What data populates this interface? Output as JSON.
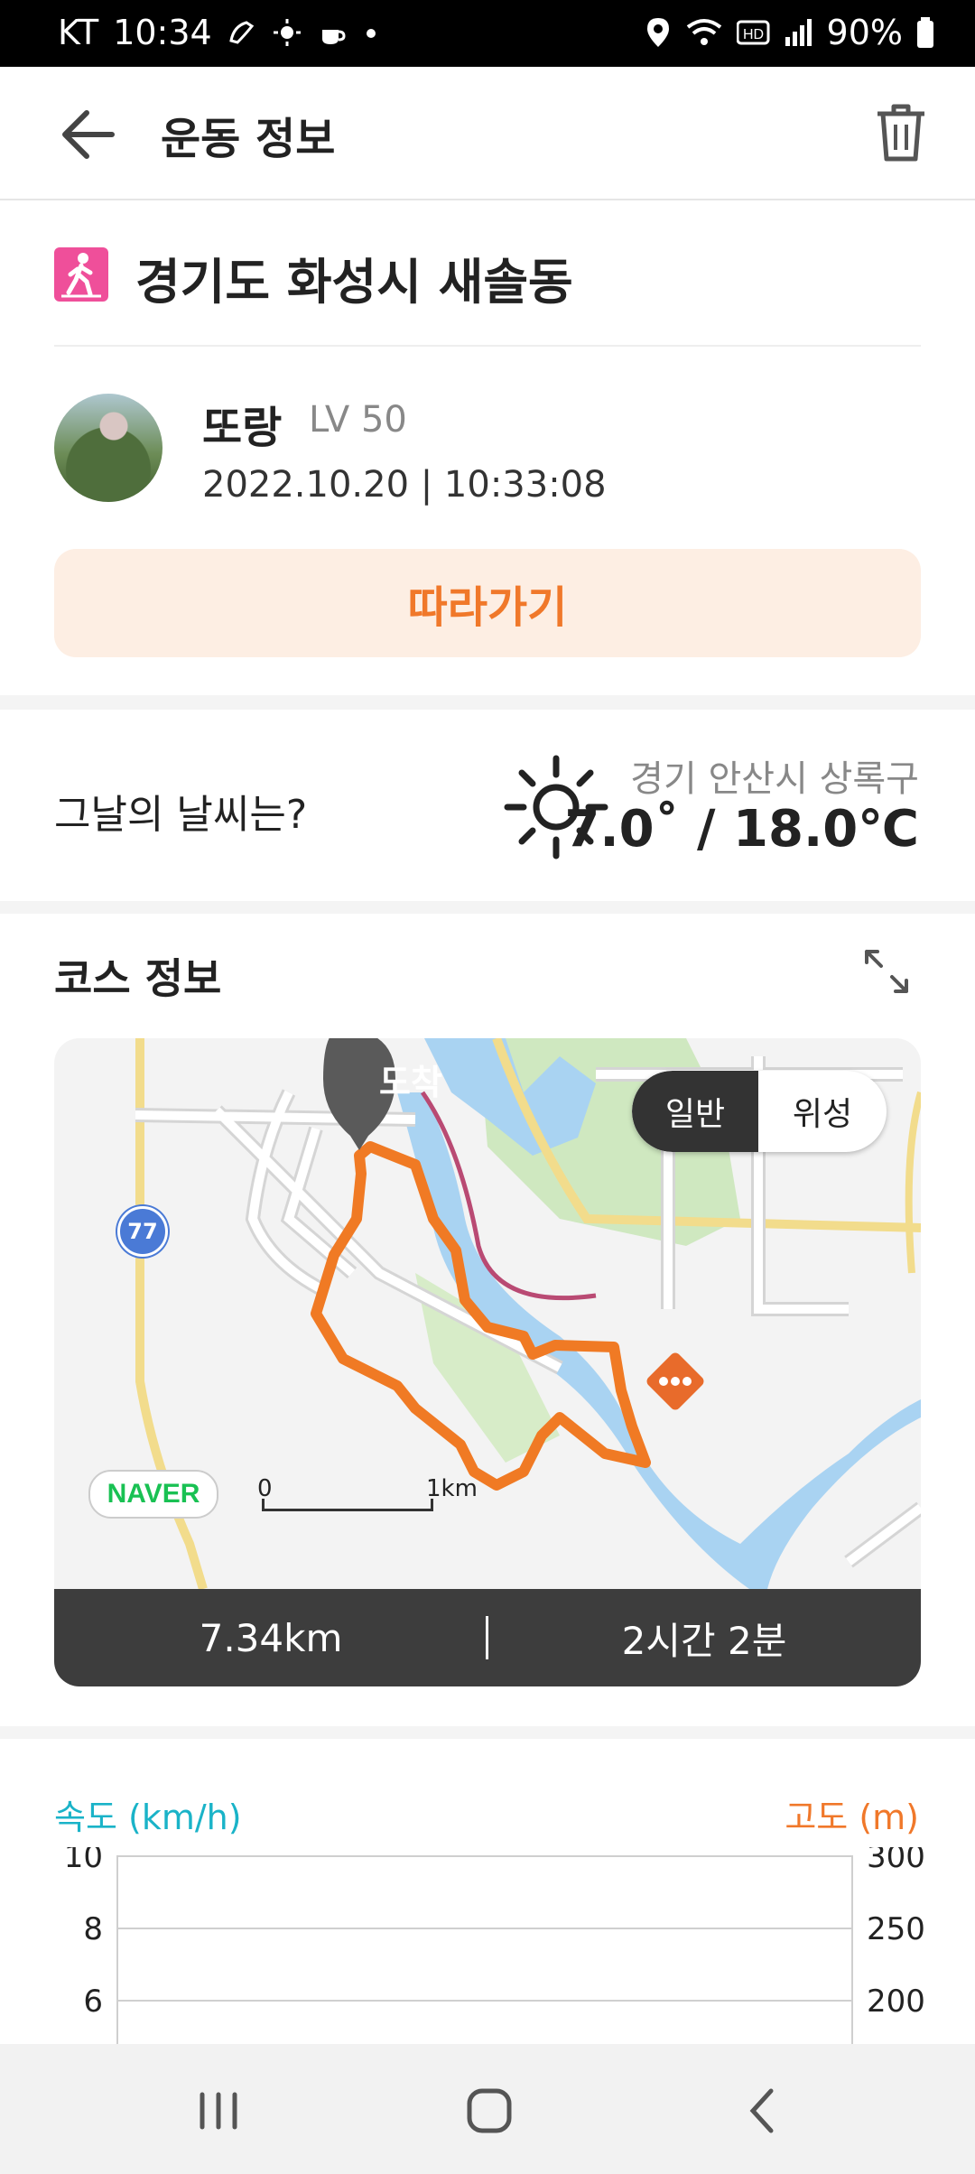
{
  "status_bar": {
    "carrier": "KT",
    "time": "10:34",
    "battery": "90%"
  },
  "header": {
    "title": "운동 정보",
    "back_icon": "arrow-left-icon",
    "delete_icon": "trash-icon"
  },
  "activity": {
    "location": "경기도 화성시 새솔동",
    "type_icon": "walking-icon",
    "user_name": "또랑",
    "level": "LV 50",
    "datetime": "2022.10.20 | 10:33:08",
    "follow_label": "따라가기"
  },
  "weather": {
    "question": "그날의 날씨는?",
    "icon": "sun-icon",
    "location": "경기 안산시 상록구",
    "temperature": "7.0˚ / 18.0℃"
  },
  "course": {
    "title": "코스 정보",
    "expand_icon": "expand-icon",
    "map": {
      "arrival_label": "도착",
      "toggle": [
        "일반",
        "위성"
      ],
      "selected": "일반",
      "route_number": "77",
      "provider": "NAVER",
      "scale_start": "0",
      "scale_end": "1km"
    },
    "distance": "7.34km",
    "duration": "2시간 2분"
  },
  "chart": {
    "speed_label": "속도 (km/h)",
    "altitude_label": "고도 (m)",
    "speed_ticks": [
      "10",
      "8",
      "6"
    ],
    "altitude_ticks": [
      "300",
      "250",
      "200"
    ]
  },
  "colors": {
    "accent": "#f0782a",
    "speed": "#1ab3c8",
    "route": "#f07a24"
  }
}
